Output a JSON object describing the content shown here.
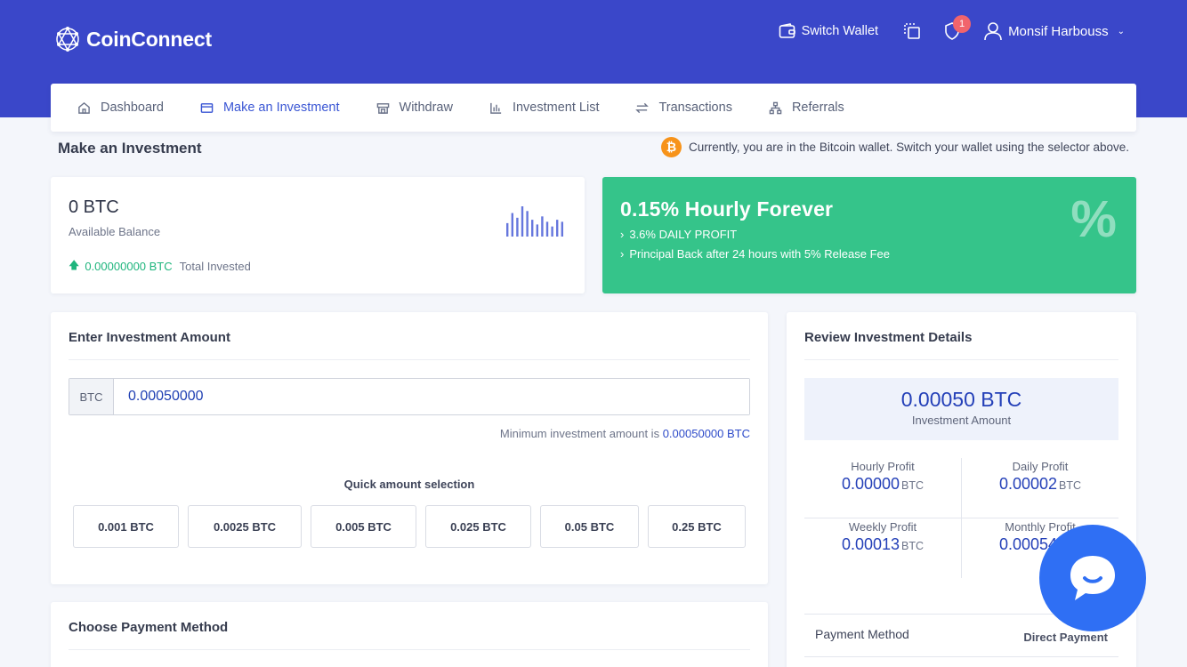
{
  "brand": {
    "name": "CoinConnect"
  },
  "header": {
    "switch_wallet": "Switch Wallet",
    "notification_count": "1",
    "user_name": "Monsif Harbouss"
  },
  "nav": {
    "items": [
      {
        "label": "Dashboard",
        "icon": "home-icon",
        "active": false
      },
      {
        "label": "Make an Investment",
        "icon": "card-icon",
        "active": true
      },
      {
        "label": "Withdraw",
        "icon": "store-icon",
        "active": false
      },
      {
        "label": "Investment List",
        "icon": "bar-chart-icon",
        "active": false
      },
      {
        "label": "Transactions",
        "icon": "swap-icon",
        "active": false
      },
      {
        "label": "Referrals",
        "icon": "sitemap-icon",
        "active": false
      }
    ]
  },
  "page": {
    "title": "Make an Investment",
    "wallet_note": "Currently, you are in the Bitcoin wallet. Switch your wallet using the selector above."
  },
  "balance": {
    "amount": "0 BTC",
    "label": "Available Balance",
    "invested_value": "0.00000000 BTC",
    "invested_label": "Total Invested",
    "sparkline": [
      20,
      35,
      28,
      45,
      38,
      25,
      18,
      30,
      22,
      15,
      25,
      22
    ]
  },
  "plan": {
    "title": "0.15% Hourly Forever",
    "lines": [
      "3.6% DAILY PROFIT",
      "Principal Back after 24 hours with 5% Release Fee"
    ],
    "badge": "%"
  },
  "investment": {
    "heading": "Enter Investment Amount",
    "currency": "BTC",
    "amount_value": "0.00050000",
    "min_text": "Minimum investment amount is",
    "min_value": "0.00050000 BTC",
    "quick_label": "Quick amount selection",
    "quick_options": [
      "0.001 BTC",
      "0.0025 BTC",
      "0.005 BTC",
      "0.025 BTC",
      "0.05 BTC",
      "0.25 BTC"
    ]
  },
  "payment": {
    "heading": "Choose Payment Method"
  },
  "review": {
    "heading": "Review Investment Details",
    "amount": "0.00050 BTC",
    "amount_label": "Investment Amount",
    "hourly_label": "Hourly Profit",
    "hourly_value": "0.00000",
    "daily_label": "Daily Profit",
    "daily_value": "0.00002",
    "weekly_label": "Weekly Profit",
    "weekly_value": "0.00013",
    "monthly_label": "Monthly Profit",
    "monthly_value": "0.00054",
    "unit": "BTC",
    "payment_method_label": "Payment Method",
    "payment_method_value": "Direct Payment"
  },
  "colors": {
    "header": "#3a47c9",
    "accent": "#3a56d4",
    "plan": "#35c48a",
    "chat": "#2f6ff4"
  }
}
